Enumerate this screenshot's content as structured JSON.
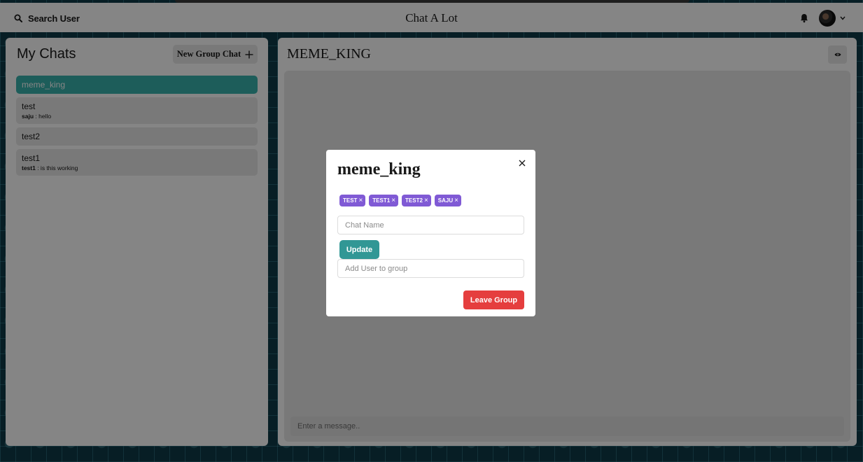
{
  "header": {
    "search_label": "Search User",
    "app_title": "Chat A Lot",
    "search_icon": "search-icon",
    "bell_icon": "bell-icon",
    "menu_icon": "chevron-down-icon"
  },
  "sidebar": {
    "title": "My Chats",
    "new_group_label": "New Group Chat",
    "new_group_icon": "plus-icon",
    "chats": [
      {
        "name": "meme_king",
        "active": true
      },
      {
        "name": "test",
        "latest_sender": "saju",
        "latest_text": " : hello"
      },
      {
        "name": "test2"
      },
      {
        "name": "test1",
        "latest_sender": "test1",
        "latest_text": " : is this working"
      }
    ]
  },
  "chat": {
    "title": "MEME_KING",
    "view_icon": "eye-icon",
    "message_placeholder": "Enter a message.."
  },
  "modal": {
    "title": "meme_king",
    "members": [
      "TEST",
      "TEST1",
      "TEST2",
      "SAJU"
    ],
    "chat_name_placeholder": "Chat Name",
    "update_label": "Update",
    "add_user_placeholder": "Add User to group",
    "leave_label": "Leave Group",
    "close_icon": "close-icon"
  },
  "colors": {
    "accent": "#38b2ac",
    "update_button": "#319795",
    "badge": "#805ad5",
    "leave_button": "#e53e3e"
  }
}
